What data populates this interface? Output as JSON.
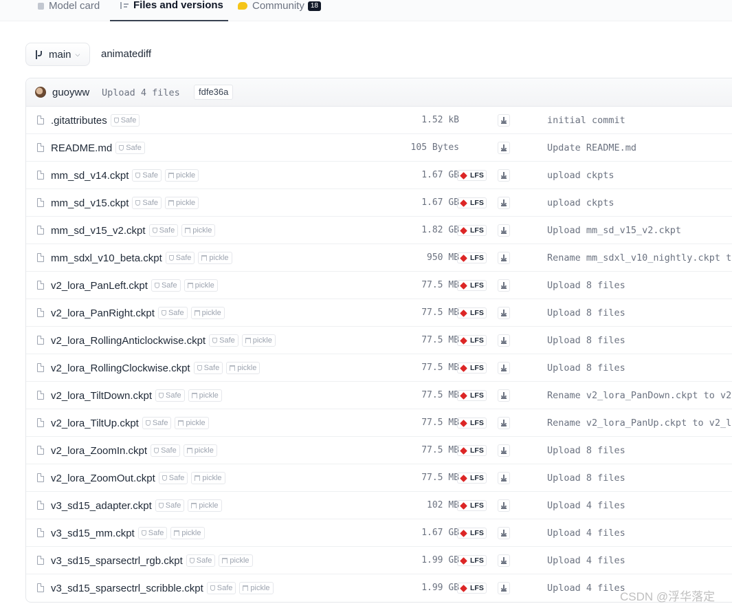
{
  "tabs": {
    "model_card": "Model card",
    "files_versions": "Files and versions",
    "community": "Community",
    "community_count": "18"
  },
  "branch": {
    "name": "main",
    "path": "animatediff"
  },
  "last_commit": {
    "author": "guoyww",
    "message": "Upload 4 files",
    "hash": "fdfe36a"
  },
  "tag_labels": {
    "safe": "Safe",
    "pickle": "pickle",
    "lfs": "LFS"
  },
  "files": [
    {
      "name": ".gitattributes",
      "pickle": false,
      "lfs": false,
      "size": "1.52 kB",
      "commit": "initial commit"
    },
    {
      "name": "README.md",
      "pickle": false,
      "lfs": false,
      "size": "105 Bytes",
      "commit": "Update README.md"
    },
    {
      "name": "mm_sd_v14.ckpt",
      "pickle": true,
      "lfs": true,
      "size": "1.67 GB",
      "commit": "upload ckpts"
    },
    {
      "name": "mm_sd_v15.ckpt",
      "pickle": true,
      "lfs": true,
      "size": "1.67 GB",
      "commit": "upload ckpts"
    },
    {
      "name": "mm_sd_v15_v2.ckpt",
      "pickle": true,
      "lfs": true,
      "size": "1.82 GB",
      "commit": "Upload mm_sd_v15_v2.ckpt"
    },
    {
      "name": "mm_sdxl_v10_beta.ckpt",
      "pickle": true,
      "lfs": true,
      "size": "950 MB",
      "commit": "Rename mm_sdxl_v10_nightly.ckpt t"
    },
    {
      "name": "v2_lora_PanLeft.ckpt",
      "pickle": true,
      "lfs": true,
      "size": "77.5 MB",
      "commit": "Upload 8 files"
    },
    {
      "name": "v2_lora_PanRight.ckpt",
      "pickle": true,
      "lfs": true,
      "size": "77.5 MB",
      "commit": "Upload 8 files"
    },
    {
      "name": "v2_lora_RollingAnticlockwise.ckpt",
      "pickle": true,
      "lfs": true,
      "size": "77.5 MB",
      "commit": "Upload 8 files"
    },
    {
      "name": "v2_lora_RollingClockwise.ckpt",
      "pickle": true,
      "lfs": true,
      "size": "77.5 MB",
      "commit": "Upload 8 files"
    },
    {
      "name": "v2_lora_TiltDown.ckpt",
      "pickle": true,
      "lfs": true,
      "size": "77.5 MB",
      "commit": "Rename v2_lora_PanDown.ckpt to v2"
    },
    {
      "name": "v2_lora_TiltUp.ckpt",
      "pickle": true,
      "lfs": true,
      "size": "77.5 MB",
      "commit": "Rename v2_lora_PanUp.ckpt to v2_l"
    },
    {
      "name": "v2_lora_ZoomIn.ckpt",
      "pickle": true,
      "lfs": true,
      "size": "77.5 MB",
      "commit": "Upload 8 files"
    },
    {
      "name": "v2_lora_ZoomOut.ckpt",
      "pickle": true,
      "lfs": true,
      "size": "77.5 MB",
      "commit": "Upload 8 files"
    },
    {
      "name": "v3_sd15_adapter.ckpt",
      "pickle": true,
      "lfs": true,
      "size": "102 MB",
      "commit": "Upload 4 files"
    },
    {
      "name": "v3_sd15_mm.ckpt",
      "pickle": true,
      "lfs": true,
      "size": "1.67 GB",
      "commit": "Upload 4 files"
    },
    {
      "name": "v3_sd15_sparsectrl_rgb.ckpt",
      "pickle": true,
      "lfs": true,
      "size": "1.99 GB",
      "commit": "Upload 4 files"
    },
    {
      "name": "v3_sd15_sparsectrl_scribble.ckpt",
      "pickle": true,
      "lfs": true,
      "size": "1.99 GB",
      "commit": "Upload 4 files"
    }
  ],
  "watermark": "CSDN @浮华落定",
  "colors": {
    "lfs_icon": "#dc2626",
    "active_tab_border": "#374151",
    "community_icon": "#f5c518"
  }
}
